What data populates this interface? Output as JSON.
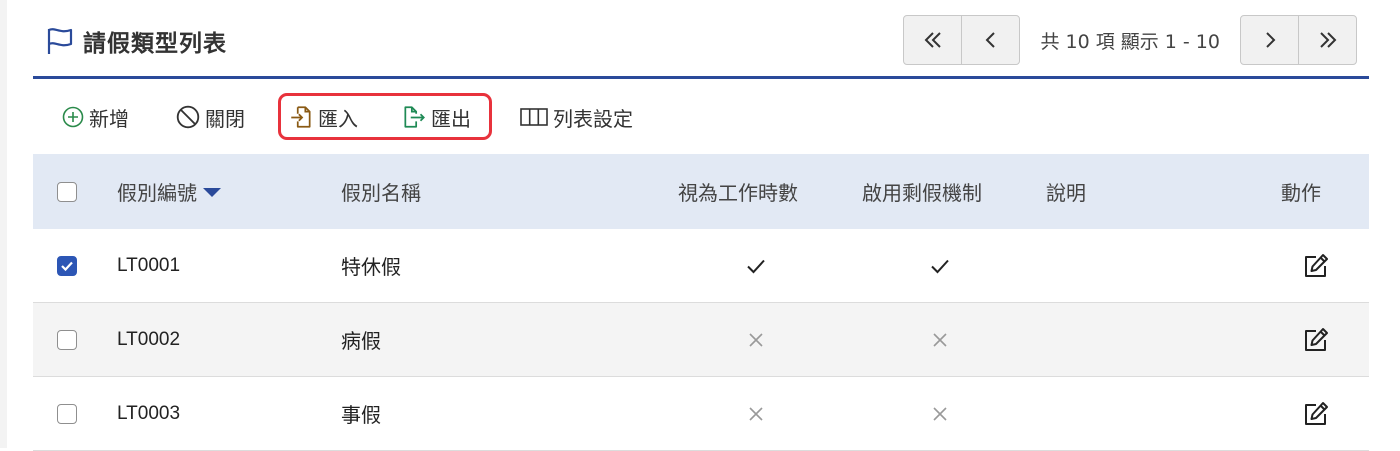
{
  "header": {
    "title": "請假類型列表",
    "pagination_info": "共 10 項 顯示 1 - 10"
  },
  "toolbar": {
    "add_label": "新增",
    "close_label": "關閉",
    "import_label": "匯入",
    "export_label": "匯出",
    "list_settings_label": "列表設定"
  },
  "table": {
    "columns": {
      "code": "假別編號",
      "name": "假別名稱",
      "work_hours": "視為工作時數",
      "leave_balance": "啟用剩假機制",
      "description": "說明",
      "action": "動作"
    },
    "sort": {
      "column": "code",
      "direction": "desc"
    },
    "rows": [
      {
        "code": "LT0001",
        "name": "特休假",
        "work_hours": true,
        "leave_balance": true,
        "description": "",
        "selected": true
      },
      {
        "code": "LT0002",
        "name": "病假",
        "work_hours": false,
        "leave_balance": false,
        "description": "",
        "selected": false
      },
      {
        "code": "LT0003",
        "name": "事假",
        "work_hours": false,
        "leave_balance": false,
        "description": "",
        "selected": false
      }
    ]
  },
  "colors": {
    "accent": "#2a4a9a",
    "header_bg": "#e2e9f4",
    "highlight_border": "#e8323c",
    "checkbox_checked": "#2c56b5"
  }
}
